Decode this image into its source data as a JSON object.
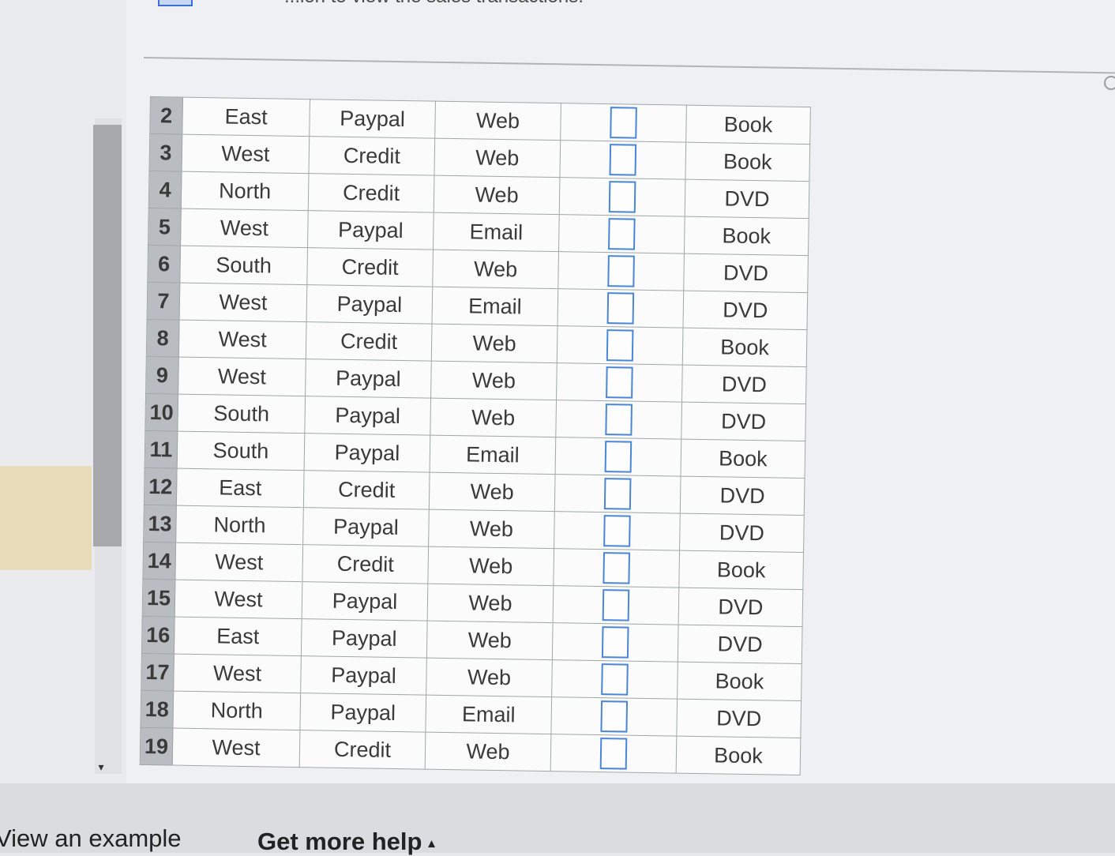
{
  "header": {
    "instruction_text": "...ion to view the sales transactions."
  },
  "grid": {
    "rows": [
      {
        "num": "2",
        "region": "East",
        "payment": "Paypal",
        "channel": "Web",
        "product": "Book"
      },
      {
        "num": "3",
        "region": "West",
        "payment": "Credit",
        "channel": "Web",
        "product": "Book"
      },
      {
        "num": "4",
        "region": "North",
        "payment": "Credit",
        "channel": "Web",
        "product": "DVD"
      },
      {
        "num": "5",
        "region": "West",
        "payment": "Paypal",
        "channel": "Email",
        "product": "Book"
      },
      {
        "num": "6",
        "region": "South",
        "payment": "Credit",
        "channel": "Web",
        "product": "DVD"
      },
      {
        "num": "7",
        "region": "West",
        "payment": "Paypal",
        "channel": "Email",
        "product": "DVD"
      },
      {
        "num": "8",
        "region": "West",
        "payment": "Credit",
        "channel": "Web",
        "product": "Book"
      },
      {
        "num": "9",
        "region": "West",
        "payment": "Paypal",
        "channel": "Web",
        "product": "DVD"
      },
      {
        "num": "10",
        "region": "South",
        "payment": "Paypal",
        "channel": "Web",
        "product": "DVD"
      },
      {
        "num": "11",
        "region": "South",
        "payment": "Paypal",
        "channel": "Email",
        "product": "Book"
      },
      {
        "num": "12",
        "region": "East",
        "payment": "Credit",
        "channel": "Web",
        "product": "DVD"
      },
      {
        "num": "13",
        "region": "North",
        "payment": "Paypal",
        "channel": "Web",
        "product": "DVD"
      },
      {
        "num": "14",
        "region": "West",
        "payment": "Credit",
        "channel": "Web",
        "product": "Book"
      },
      {
        "num": "15",
        "region": "West",
        "payment": "Paypal",
        "channel": "Web",
        "product": "DVD"
      },
      {
        "num": "16",
        "region": "East",
        "payment": "Paypal",
        "channel": "Web",
        "product": "DVD"
      },
      {
        "num": "17",
        "region": "West",
        "payment": "Paypal",
        "channel": "Web",
        "product": "Book"
      },
      {
        "num": "18",
        "region": "North",
        "payment": "Paypal",
        "channel": "Email",
        "product": "DVD"
      },
      {
        "num": "19",
        "region": "West",
        "payment": "Credit",
        "channel": "Web",
        "product": "Book"
      }
    ]
  },
  "footer": {
    "view_example": "View an example",
    "get_more_help": "Get more help"
  },
  "icons": {
    "help_caret": "caret-up-icon",
    "scroll_down": "scroll-down-arrow-icon"
  },
  "colors": {
    "checkbox_border": "#4a86d6",
    "row_header_bg": "#b9bcc0",
    "highlight": "#e8dcb8"
  }
}
